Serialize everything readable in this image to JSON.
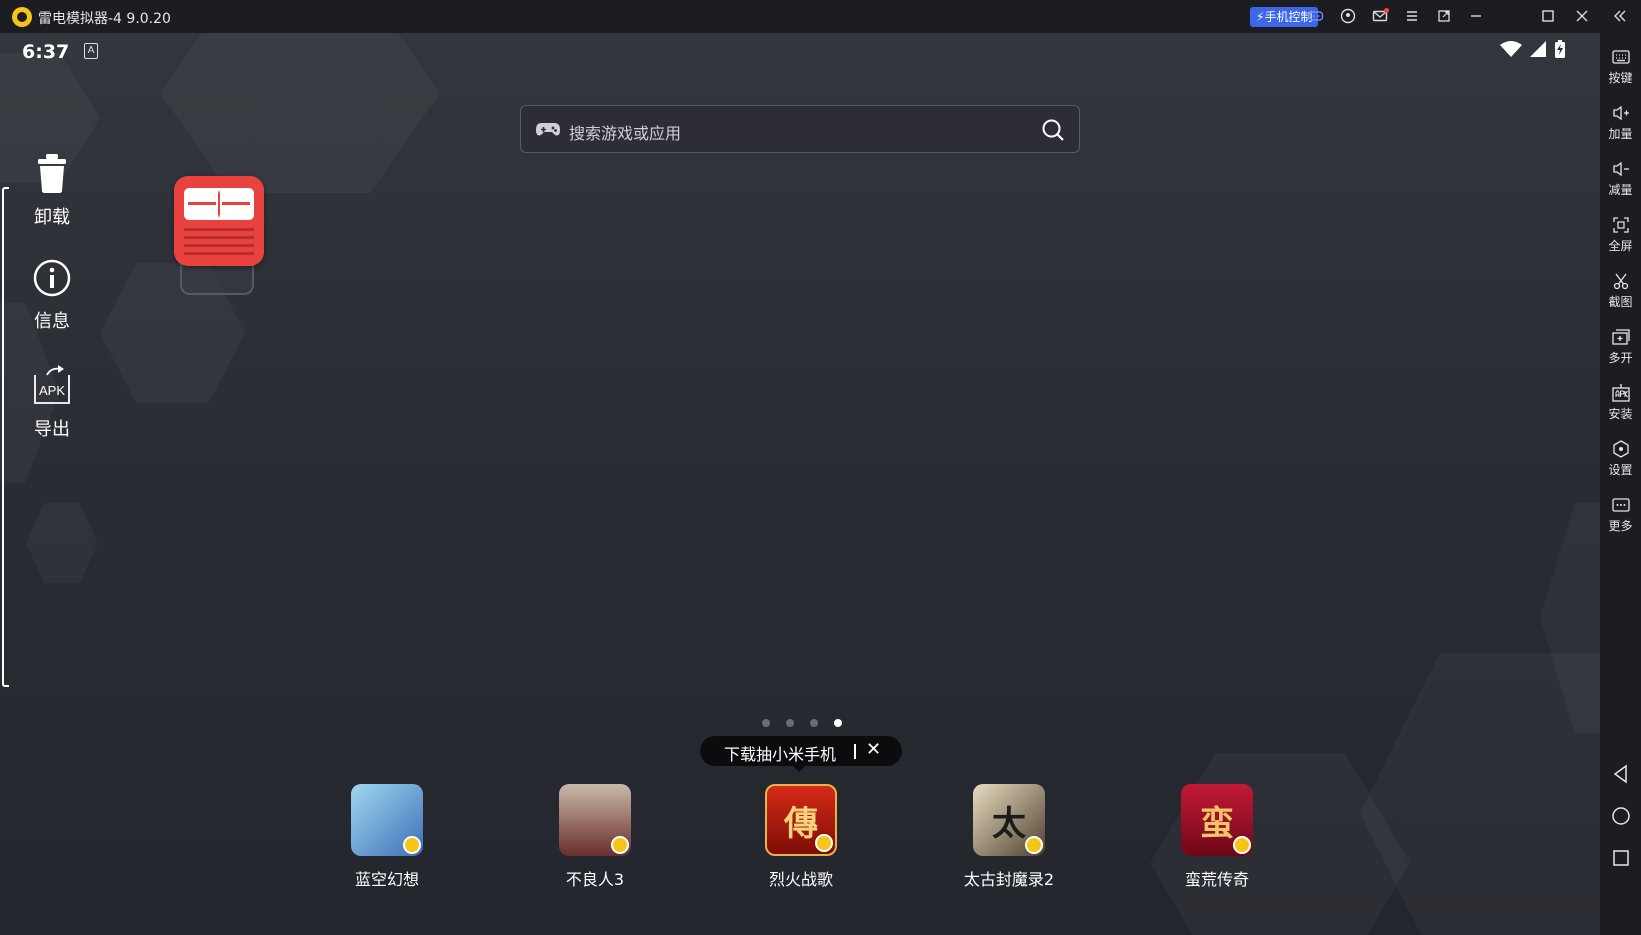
{
  "window": {
    "title": "雷电模拟器-4 9.0.20",
    "phone_control": "手机控制"
  },
  "status": {
    "time": "6:37",
    "notif_letter": "A"
  },
  "search": {
    "placeholder": "搜索游戏或应用"
  },
  "left_actions": [
    {
      "label": "卸载",
      "icon": "trash-icon"
    },
    {
      "label": "信息",
      "icon": "info-icon"
    },
    {
      "label": "导出",
      "icon": "apk-export-icon"
    }
  ],
  "apk_text": "APK",
  "pages": {
    "count": 4,
    "active": 3
  },
  "tooltip": {
    "text": "下载抽小米手机",
    "close": "✕"
  },
  "dock": [
    {
      "label": "蓝空幻想",
      "bg": "#5a8fd0",
      "glyph": ""
    },
    {
      "label": "不良人3",
      "bg": "#7a3b3b",
      "glyph": ""
    },
    {
      "label": "烈火战歌",
      "bg": "#b3160f",
      "glyph": "傳"
    },
    {
      "label": "太古封魔录2",
      "bg": "#8a7a5a",
      "glyph": "太"
    },
    {
      "label": "蛮荒传奇",
      "bg": "#a3102a",
      "glyph": "蛮"
    }
  ],
  "rightbar": [
    {
      "label": "按键",
      "icon": "keyboard-icon"
    },
    {
      "label": "加量",
      "icon": "volume-up-icon"
    },
    {
      "label": "减量",
      "icon": "volume-down-icon"
    },
    {
      "label": "全屏",
      "icon": "fullscreen-icon"
    },
    {
      "label": "截图",
      "icon": "scissors-icon"
    },
    {
      "label": "多开",
      "icon": "multi-instance-icon"
    },
    {
      "label": "安装",
      "icon": "apk-install-icon"
    },
    {
      "label": "设置",
      "icon": "settings-icon"
    },
    {
      "label": "更多",
      "icon": "more-icon"
    }
  ],
  "colors": {
    "accent_blue": "#3d67e8",
    "logo_yellow": "#f5c518",
    "app_red": "#e8423f",
    "mail_dot": "#ff4040"
  }
}
